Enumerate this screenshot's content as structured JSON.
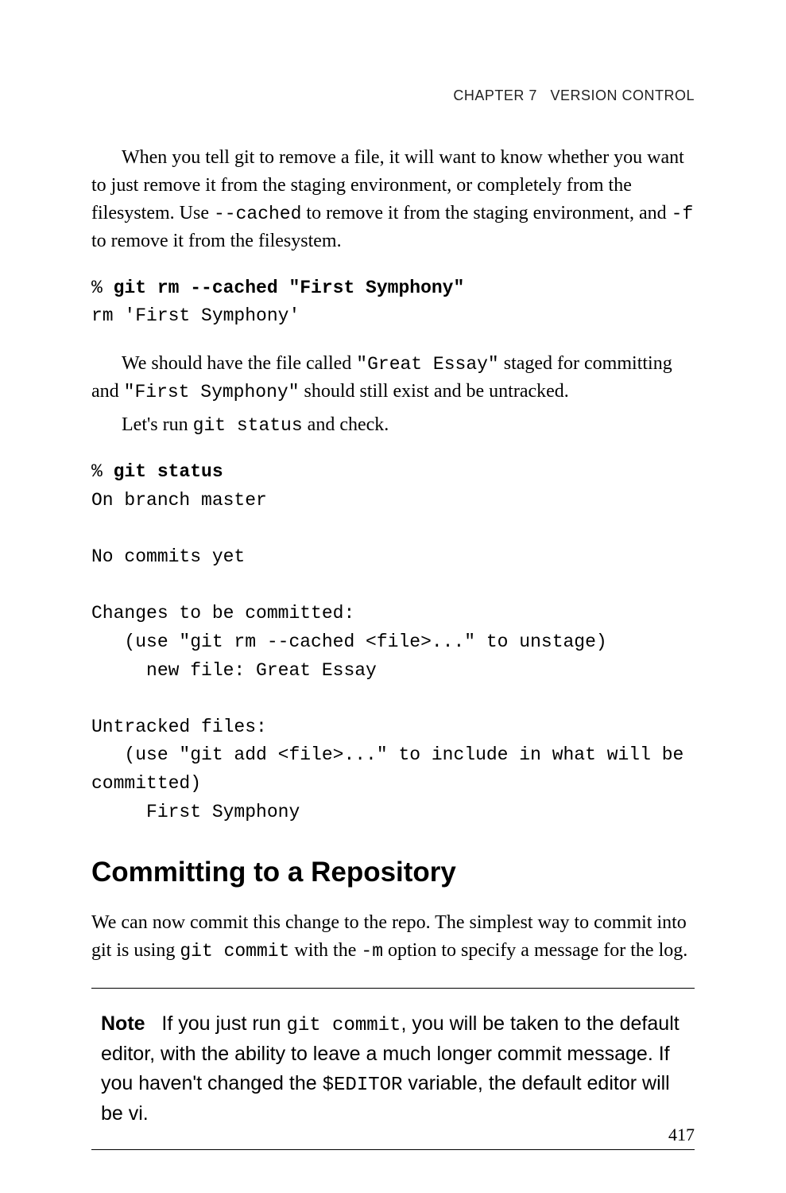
{
  "header": {
    "chapter_label": "CHAPTER 7",
    "chapter_title": "VERSION CONTROL"
  },
  "paragraphs": {
    "p1_part1": "When you tell git to remove a file, it will want to know whether you want to just remove it from the staging environment, or completely from the filesystem. Use ",
    "p1_code1": "--cached",
    "p1_part2": " to remove it from the staging environment, and ",
    "p1_code2": "-f",
    "p1_part3": " to remove it from the filesystem.",
    "p2_part1": "We should have the file called ",
    "p2_code1": "\"Great Essay\"",
    "p2_part2": " staged for committing and ",
    "p2_code2": "\"First Symphony\"",
    "p2_part3": " should still exist and be untracked.",
    "p3_part1": "Let's run ",
    "p3_code1": "git status",
    "p3_part2": " and check.",
    "p4": "We can now commit this change to the repo. The simplest way to commit into git is using ",
    "p4_code1": "git commit",
    "p4_part2": " with the ",
    "p4_code2": "-m",
    "p4_part3": " option to specify a message for the log."
  },
  "code": {
    "block1_prompt": "% ",
    "block1_cmd": "git rm --cached \"First Symphony\"",
    "block1_out": "rm 'First Symphony'",
    "block2_prompt": "% ",
    "block2_cmd": "git status",
    "block2_out": "On branch master\n\nNo commits yet\n\nChanges to be committed:\n   (use \"git rm --cached <file>...\" to unstage)\n     new file: Great Essay\n\nUntracked files:\n   (use \"git add <file>...\" to include in what will be\ncommitted)\n     First Symphony"
  },
  "heading": "Committing to a Repository",
  "note": {
    "label": "Note",
    "part1": "If you just run ",
    "code1": "git commit",
    "part2": ", you will be taken to the default editor, with the ability to leave a much longer commit message. If you haven't changed the ",
    "code2": "$EDITOR",
    "part3": " variable, the default editor will be vi."
  },
  "page_number": "417"
}
